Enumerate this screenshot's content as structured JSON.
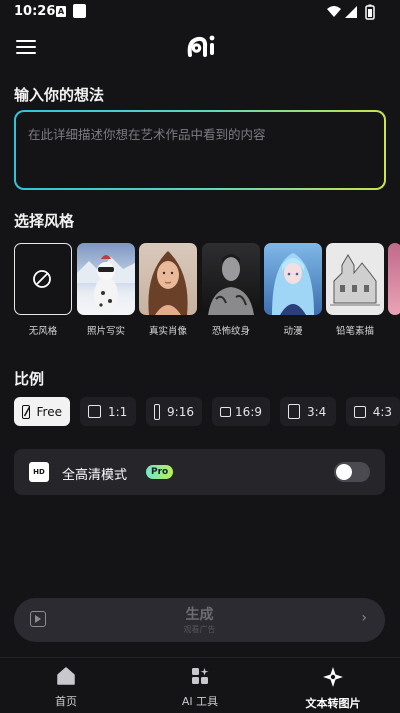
{
  "status_bar": {
    "time": "10:26",
    "notif_a": "A"
  },
  "header": {
    "logo_text": "ai"
  },
  "prompt": {
    "section_title": "输入你的想法",
    "placeholder": "在此详细描述你想在艺术作品中看到的内容"
  },
  "styles": {
    "section_title": "选择风格",
    "items": [
      {
        "label": "无风格"
      },
      {
        "label": "照片写实"
      },
      {
        "label": "真实肖像"
      },
      {
        "label": "恐怖纹身"
      },
      {
        "label": "动漫"
      },
      {
        "label": "铅笔素描"
      }
    ]
  },
  "ratio": {
    "section_title": "比例",
    "options": [
      {
        "label": "Free"
      },
      {
        "label": "1:1"
      },
      {
        "label": "9:16"
      },
      {
        "label": "16:9"
      },
      {
        "label": "3:4"
      },
      {
        "label": "4:3"
      }
    ]
  },
  "hd": {
    "icon_text": "HD",
    "label": "全高清模式",
    "badge": "Pro",
    "enabled": false
  },
  "generate": {
    "label": "生成",
    "sublabel": "观看广告"
  },
  "nav": {
    "items": [
      {
        "label": "首页"
      },
      {
        "label": "AI 工具"
      },
      {
        "label": "文本转图片"
      }
    ]
  }
}
